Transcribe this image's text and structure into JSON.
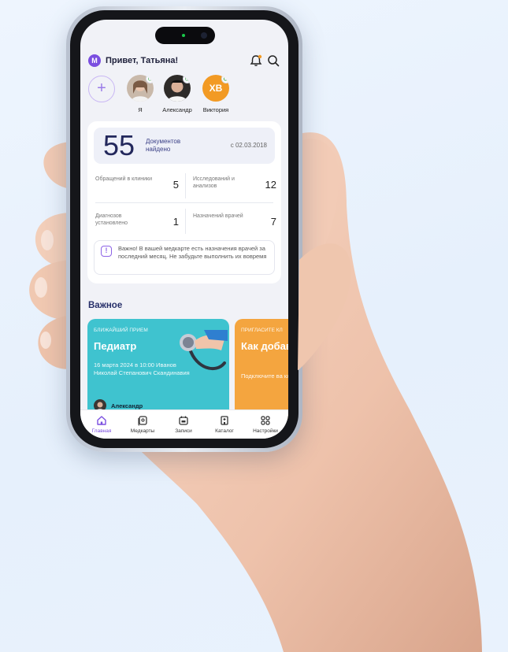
{
  "header": {
    "avatar_letter": "М",
    "greeting": "Привет, Татьяна!"
  },
  "profiles": [
    {
      "name": "Я"
    },
    {
      "name": "Александр"
    },
    {
      "name": "Виктория",
      "initials": "ХВ"
    }
  ],
  "documents": {
    "count": "55",
    "label": "Документов найдено",
    "since": "с 02.03.2018"
  },
  "stats": [
    {
      "label": "Обращений в клиники",
      "value": "5"
    },
    {
      "label": "Исследований и анализов",
      "value": "12"
    },
    {
      "label": "Диагнозов установлено",
      "value": "1"
    },
    {
      "label": "Назначений врачей",
      "value": "7"
    }
  ],
  "notice": {
    "icon": "!",
    "text": "Важно! В вашей медкарте есть назначения врачей за последний месяц. Не забудьте выполнить их вовремя"
  },
  "important": {
    "title": "Важное",
    "appointment": {
      "kicker": "БЛИЖАЙШИЙ ПРИЕМ",
      "title": "Педиатр",
      "details": "16 марта 2024 в 10:00 Иванов Николай Степанович Скандинавия",
      "person": "Александр"
    },
    "invite": {
      "kicker": "ПРИГЛАСИТЕ КЛ",
      "title": "Как добав свою клин",
      "details": "Подключите ва клинику и полу из нее мед. да"
    }
  },
  "nav": [
    {
      "label": "Главная",
      "icon": "home-icon",
      "active": true
    },
    {
      "label": "Медкарты",
      "icon": "medcard-icon"
    },
    {
      "label": "Записи",
      "icon": "calendar-icon"
    },
    {
      "label": "Каталог",
      "icon": "hospital-icon"
    },
    {
      "label": "Настройки",
      "icon": "settings-icon"
    }
  ],
  "colors": {
    "accent": "#7b4fe0",
    "teal_card": "#3fc3cf",
    "orange_card": "#f4a53f",
    "dark_text": "#23285c"
  }
}
